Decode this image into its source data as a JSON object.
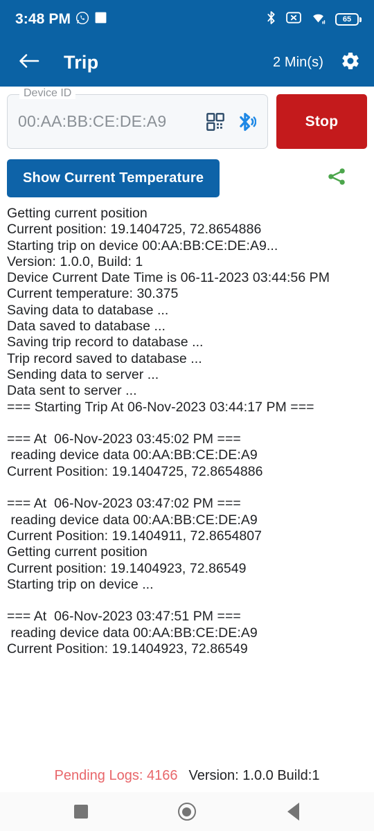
{
  "status_bar": {
    "time": "3:48 PM",
    "battery_level": "65",
    "icons": [
      "whatsapp-icon",
      "app-square-icon",
      "bluetooth-icon",
      "no-sim-icon",
      "wifi-icon",
      "battery-icon"
    ],
    "background_color": "#0B62A4"
  },
  "app_bar": {
    "back_label": "back-arrow",
    "title": "Trip",
    "timer": "2 Min(s)",
    "settings_label": "settings",
    "background_color": "#0B62A4"
  },
  "device_field": {
    "legend": "Device ID",
    "value": "00:AA:BB:CE:DE:A9",
    "placeholder": "00:AA:BB:CE:DE:A9",
    "qr_icon_label": "qr-scan",
    "bluetooth_icon_label": "bluetooth-search"
  },
  "stop_button": {
    "label": "Stop",
    "color": "#C41A1C"
  },
  "temperature_button": {
    "label": "Show Current Temperature",
    "color": "#0E63A8"
  },
  "share_button": {
    "label": "share",
    "color": "#4CA64C"
  },
  "log": {
    "text": "Getting current position\nCurrent position: 19.1404725, 72.8654886\nStarting trip on device 00:AA:BB:CE:DE:A9...\nVersion: 1.0.0, Build: 1\nDevice Current Date Time is 06-11-2023 03:44:56 PM\nCurrent temperature: 30.375\nSaving data to database ...\nData saved to database ...\nSaving trip record to database ...\nTrip record saved to database ...\nSending data to server ...\nData sent to server ...\n=== Starting Trip At 06-Nov-2023 03:44:17 PM ===\n\n=== At  06-Nov-2023 03:45:02 PM ===\n reading device data 00:AA:BB:CE:DE:A9\nCurrent Position: 19.1404725, 72.8654886\n\n=== At  06-Nov-2023 03:47:02 PM ===\n reading device data 00:AA:BB:CE:DE:A9\nCurrent Position: 19.1404911, 72.8654807\nGetting current position\nCurrent position: 19.1404923, 72.86549\nStarting trip on device ...\n\n=== At  06-Nov-2023 03:47:51 PM ===\n reading device data 00:AA:BB:CE:DE:A9\nCurrent Position: 19.1404923, 72.86549",
    "lines": [
      "Getting current position",
      "Current position: 19.1404725, 72.8654886",
      "Starting trip on device 00:AA:BB:CE:DE:A9...",
      "Version: 1.0.0, Build: 1",
      "Device Current Date Time is 06-11-2023 03:44:56 PM",
      "Current temperature: 30.375",
      "Saving data to database ...",
      "Data saved to database ...",
      "Saving trip record to database ...",
      "Trip record saved to database ...",
      "Sending data to server ...",
      "Data sent to server ...",
      "=== Starting Trip At 06-Nov-2023 03:44:17 PM ===",
      "",
      "=== At  06-Nov-2023 03:45:02 PM ===",
      " reading device data 00:AA:BB:CE:DE:A9",
      "Current Position: 19.1404725, 72.8654886",
      "",
      "=== At  06-Nov-2023 03:47:02 PM ===",
      " reading device data 00:AA:BB:CE:DE:A9",
      "Current Position: 19.1404911, 72.8654807",
      "Getting current position",
      "Current position: 19.1404923, 72.86549",
      "Starting trip on device ...",
      "",
      "=== At  06-Nov-2023 03:47:51 PM ===",
      " reading device data 00:AA:BB:CE:DE:A9",
      "Current Position: 19.1404923, 72.86549"
    ]
  },
  "footer": {
    "pending_logs": "Pending Logs: 4166",
    "version": "Version: 1.0.0 Build:1",
    "pending_color": "#E8666A"
  },
  "nav_bar": {
    "recents_label": "recents",
    "home_label": "home",
    "back_label": "back"
  }
}
